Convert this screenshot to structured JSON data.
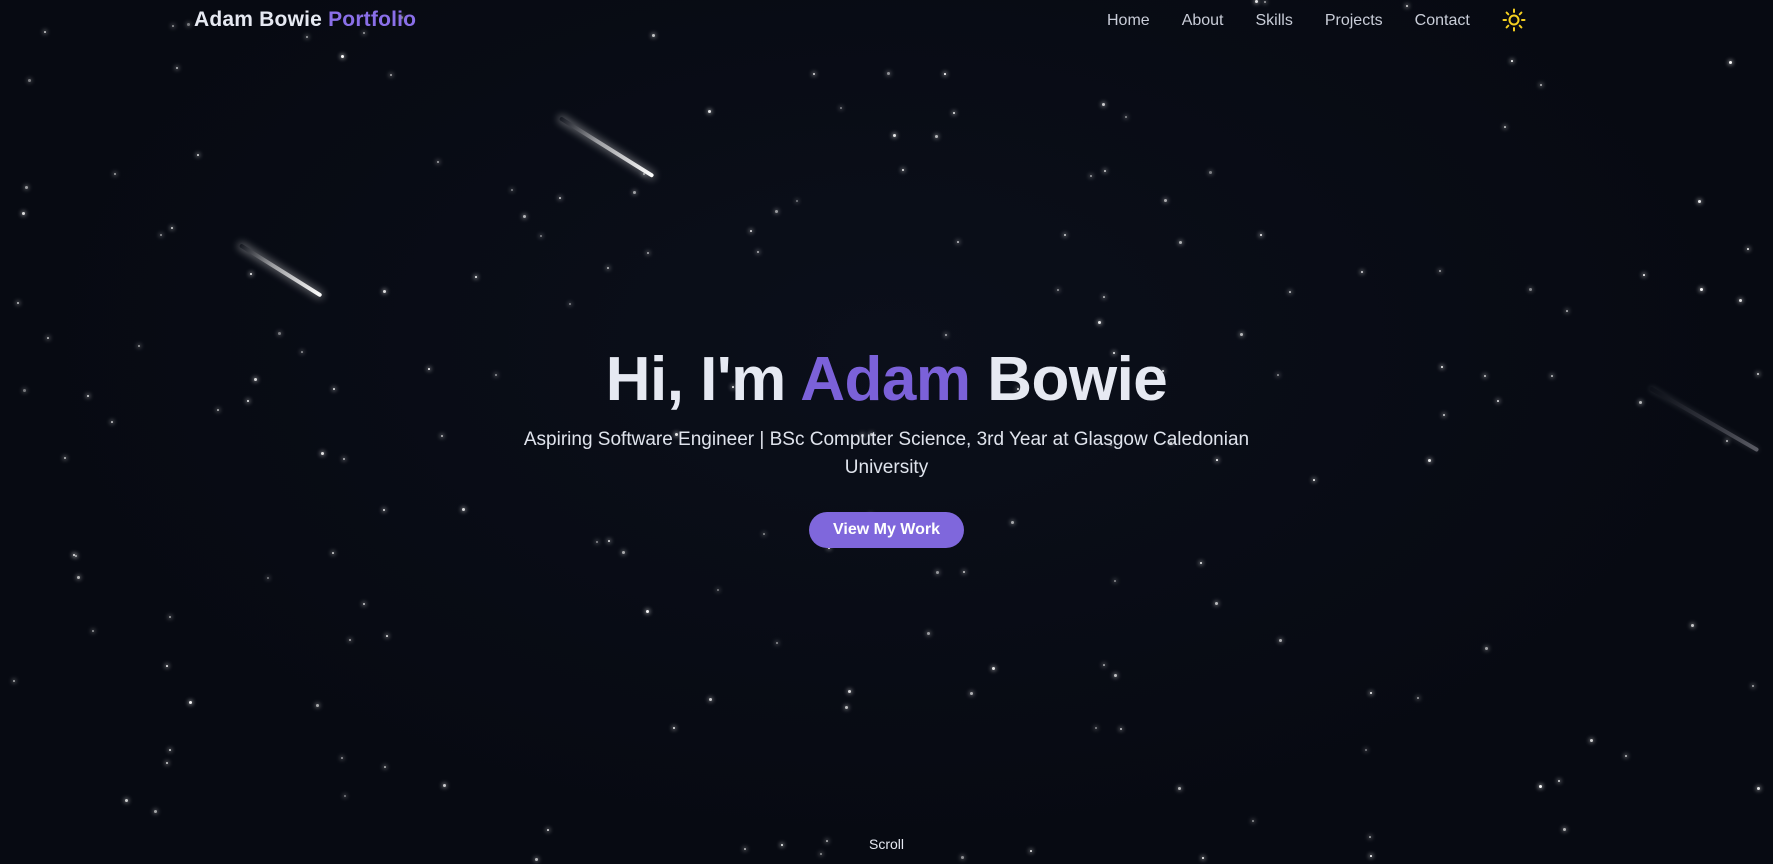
{
  "nav": {
    "brand_name": "Adam Bowie",
    "brand_accent": "Portfolio",
    "links": [
      "Home",
      "About",
      "Skills",
      "Projects",
      "Contact"
    ],
    "theme_icon": "sun-icon"
  },
  "hero": {
    "greeting": "Hi, I'm",
    "first_name": "Adam",
    "last_name": "Bowie",
    "subtitle": "Aspiring Software Engineer | BSc Computer Science, 3rd Year at Glasgow Caledonian University",
    "cta_label": "View My Work"
  },
  "scroll_label": "Scroll",
  "colors": {
    "background": "#070a12",
    "accent": "#7b61d9",
    "button": "#7f67dc",
    "sun": "#f5d020"
  }
}
